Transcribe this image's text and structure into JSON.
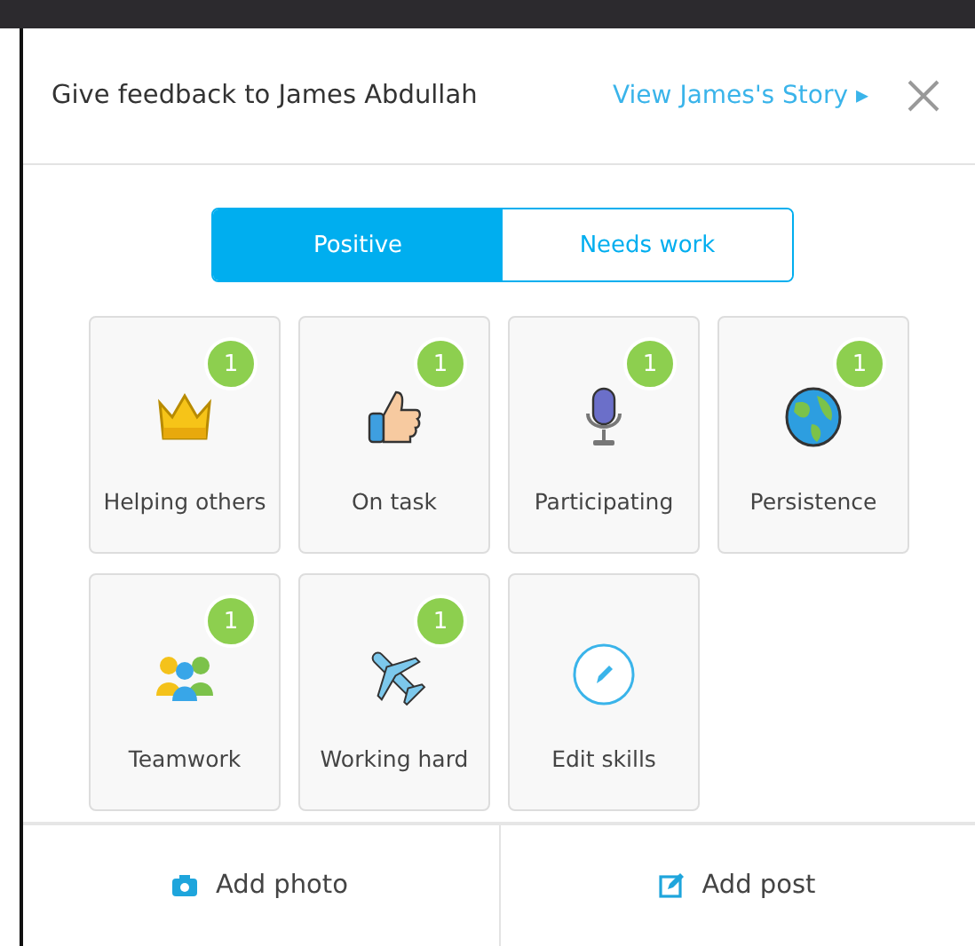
{
  "dialog": {
    "title": "Give feedback to James Abdullah",
    "story_link": "View James's Story ▸"
  },
  "tabs": [
    {
      "label": "Positive",
      "selected": true
    },
    {
      "label": "Needs work",
      "selected": false
    }
  ],
  "skills": [
    {
      "kind": "skill",
      "label": "Helping others",
      "count": "1"
    },
    {
      "kind": "skill",
      "label": "On task",
      "count": "1"
    },
    {
      "kind": "skill",
      "label": "Participating",
      "count": "1"
    },
    {
      "kind": "skill",
      "label": "Persistence",
      "count": "1"
    },
    {
      "kind": "skill",
      "label": "Teamwork",
      "count": "1"
    },
    {
      "kind": "skill",
      "label": "Working hard",
      "count": "1"
    },
    {
      "kind": "edit",
      "label": "Edit skills"
    }
  ],
  "footer_buttons": [
    {
      "kind": "photo",
      "label": "Add photo"
    },
    {
      "kind": "post",
      "label": "Add post"
    }
  ]
}
